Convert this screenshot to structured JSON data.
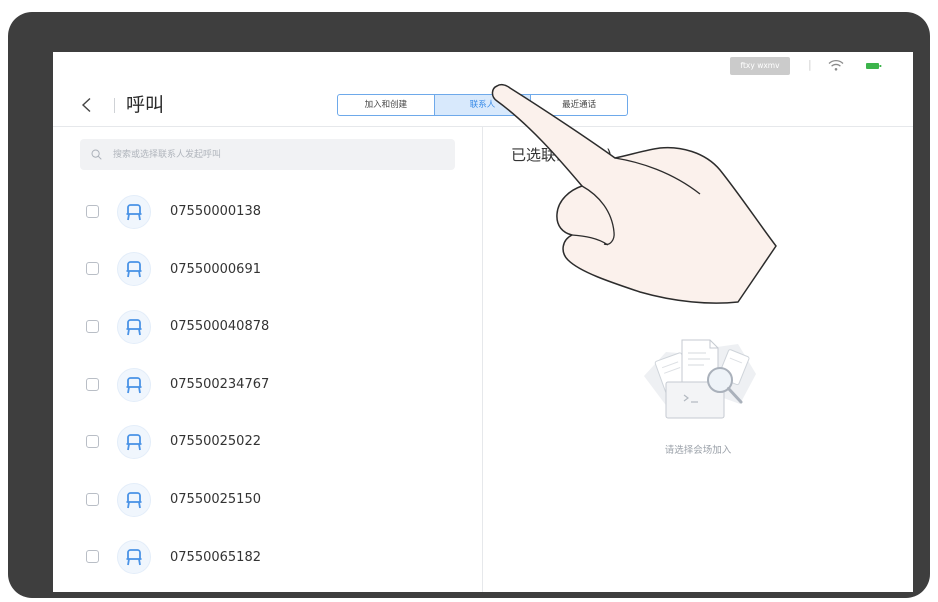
{
  "status_bar": {
    "account_badge": "ftxy wxmv",
    "separator": "|",
    "wifi_icon": "wifi-icon",
    "battery_icon": "battery-icon"
  },
  "header": {
    "back_icon": "chevron-left-icon",
    "title": "呼叫"
  },
  "tabs": [
    {
      "label": "加入和创建",
      "selected": false
    },
    {
      "label": "联系人",
      "selected": true
    },
    {
      "label": "最近通话",
      "selected": false
    }
  ],
  "search": {
    "icon": "search-icon",
    "placeholder": "搜索或选择联系人发起呼叫"
  },
  "contacts": [
    {
      "number": "07550000138",
      "checked": false,
      "avatar_icon": "venue-icon"
    },
    {
      "number": "07550000691",
      "checked": false,
      "avatar_icon": "venue-icon"
    },
    {
      "number": "075500040878",
      "checked": false,
      "avatar_icon": "venue-icon"
    },
    {
      "number": "075500234767",
      "checked": false,
      "avatar_icon": "venue-icon"
    },
    {
      "number": "07550025022",
      "checked": false,
      "avatar_icon": "venue-icon"
    },
    {
      "number": "07550025150",
      "checked": false,
      "avatar_icon": "venue-icon"
    },
    {
      "number": "07550065182",
      "checked": false,
      "avatar_icon": "venue-icon"
    }
  ],
  "selected_panel": {
    "title": "已选联系人 (0)",
    "empty_icon": "empty-documents-icon",
    "empty_text": "请选择会场加入"
  },
  "overlay": {
    "icon": "pointing-hand-icon"
  },
  "colors": {
    "accent": "#3a8ce8",
    "tab_selected_bg": "#d8e9fc",
    "device_frame": "#3e3e3e",
    "text": "#333333",
    "muted": "#a0a6ae",
    "badge_bg": "#cbcbcb",
    "battery": "#3cb44b"
  }
}
